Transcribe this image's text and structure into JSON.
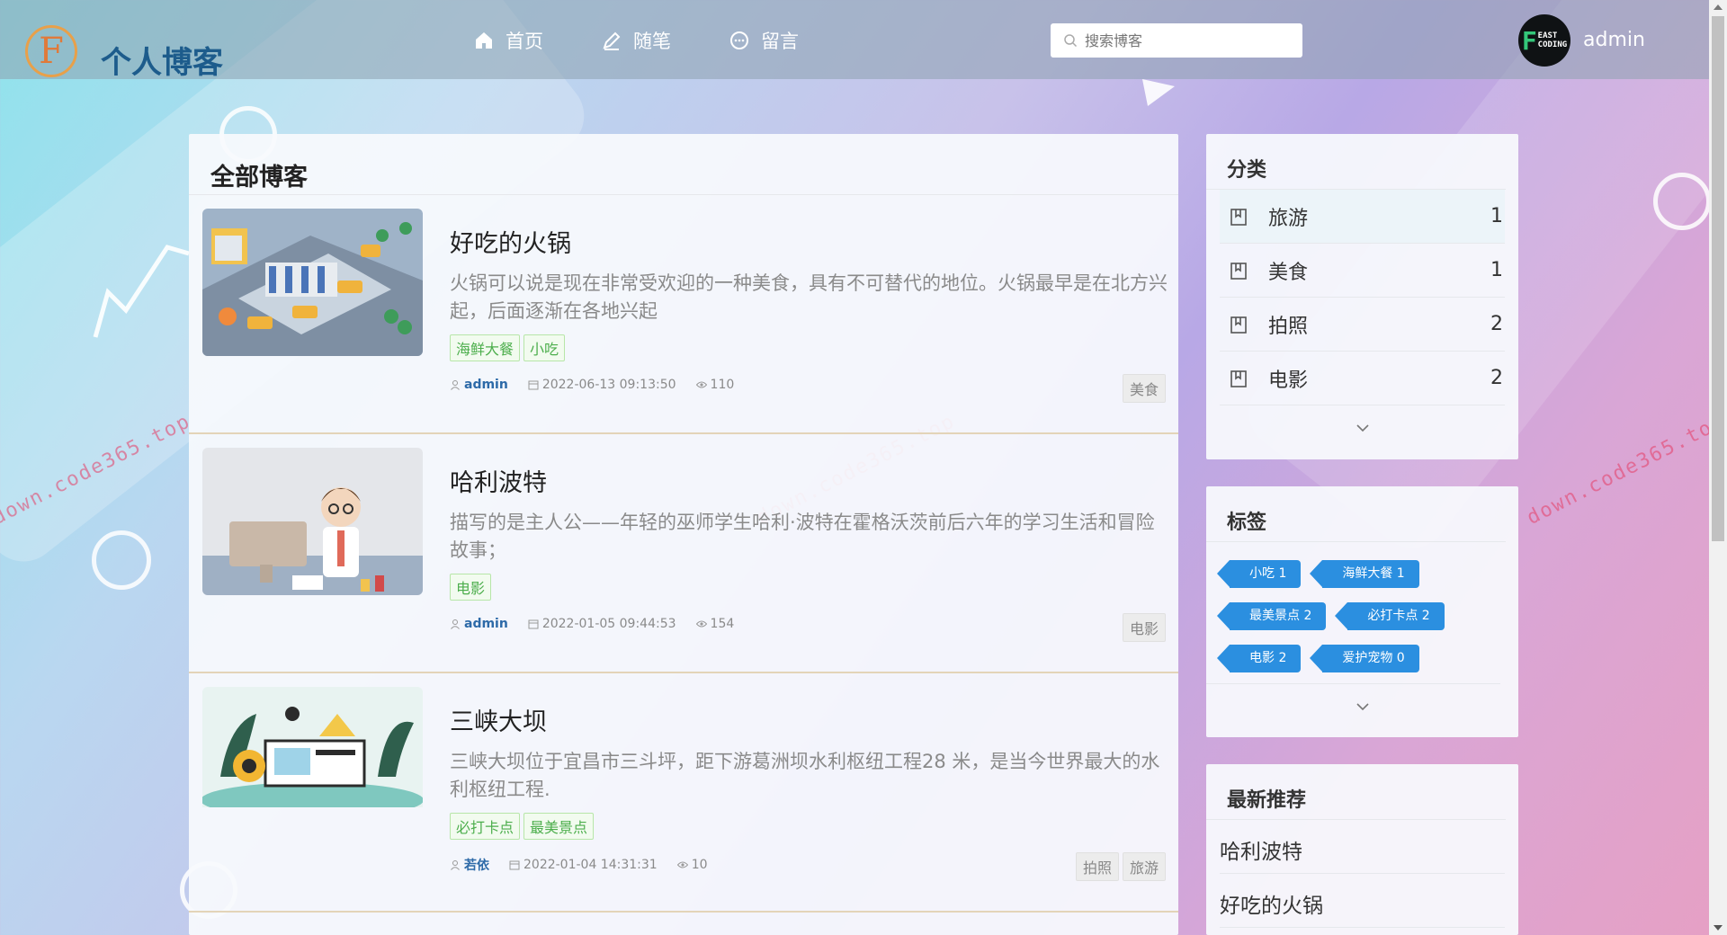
{
  "site": {
    "logo_letter": "F",
    "title": "个人博客"
  },
  "nav": [
    {
      "label": "首页",
      "icon": "home-icon"
    },
    {
      "label": "随笔",
      "icon": "pen-icon"
    },
    {
      "label": "留言",
      "icon": "message-icon"
    }
  ],
  "search": {
    "placeholder": "搜索博客"
  },
  "user": {
    "name": "admin",
    "avatar_big": "F",
    "avatar_small_1": "EAST",
    "avatar_small_2": "CODING"
  },
  "watermark": "down.code365.top",
  "main": {
    "title": "全部博客",
    "posts": [
      {
        "title": "好吃的火锅",
        "summary": "火锅可以说是现在非常受欢迎的一种美食，具有不可替代的地位。火锅最早是在北方兴起，后面逐渐在各地兴起",
        "tags": [
          "海鲜大餐",
          "小吃"
        ],
        "author": "admin",
        "date": "2022-06-13 09:13:50",
        "views": "110",
        "categories": [
          "美食"
        ]
      },
      {
        "title": "哈利波特",
        "summary": "描写的是主人公——年轻的巫师学生哈利·波特在霍格沃茨前后六年的学习生活和冒险故事；",
        "tags": [
          "电影"
        ],
        "author": "admin",
        "date": "2022-01-05 09:44:53",
        "views": "154",
        "categories": [
          "电影"
        ]
      },
      {
        "title": "三峡大坝",
        "summary": "三峡大坝位于宜昌市三斗坪，距下游葛洲坝水利枢纽工程28 米，是当今世界最大的水利枢纽工程.",
        "tags": [
          "必打卡点",
          "最美景点"
        ],
        "author": "若依",
        "date": "2022-01-04 14:31:31",
        "views": "10",
        "categories": [
          "拍照",
          "旅游"
        ]
      }
    ]
  },
  "sidebar": {
    "categories": {
      "title": "分类",
      "items": [
        {
          "name": "旅游",
          "count": "1"
        },
        {
          "name": "美食",
          "count": "1"
        },
        {
          "name": "拍照",
          "count": "2"
        },
        {
          "name": "电影",
          "count": "2"
        }
      ]
    },
    "tags": {
      "title": "标签",
      "items": [
        "小吃 1",
        "海鲜大餐 1",
        "最美景点 2",
        "必打卡点 2",
        "电影 2",
        "爱护宠物 0"
      ]
    },
    "recommend": {
      "title": "最新推荐",
      "items": [
        "哈利波特",
        "好吃的火锅"
      ]
    }
  },
  "colors": {
    "accent": "#2b8fe0",
    "tag_green": "#4cae4c",
    "title_blue": "#1d5c8c"
  }
}
